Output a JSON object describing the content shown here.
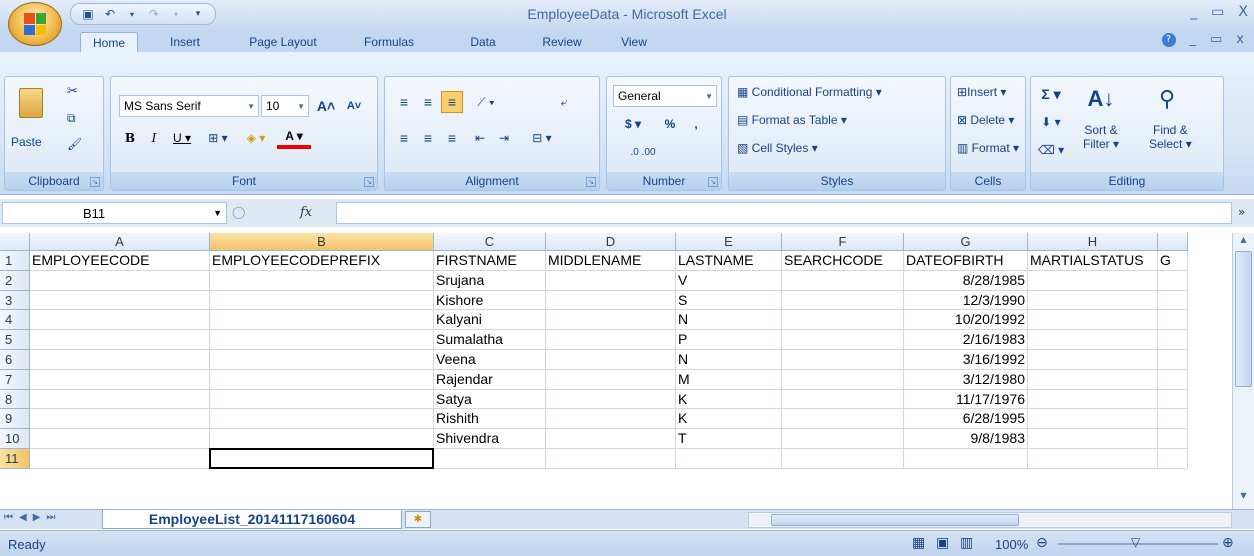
{
  "window": {
    "title": "EmployeeData - Microsoft Excel",
    "minimize": "_",
    "maximize": "▭",
    "close": "X"
  },
  "tabs": [
    "Home",
    "Insert",
    "Page Layout",
    "Formulas",
    "Data",
    "Review",
    "View"
  ],
  "active_tab": "Home",
  "ribbon": {
    "clipboard": {
      "label": "Clipboard",
      "paste": "Paste"
    },
    "font": {
      "label": "Font",
      "font_name": "MS Sans Serif",
      "font_size": "10"
    },
    "alignment": {
      "label": "Alignment"
    },
    "number": {
      "label": "Number",
      "format": "General"
    },
    "styles": {
      "label": "Styles",
      "conditional": "Conditional Formatting",
      "format_table": "Format as Table",
      "cell_styles": "Cell Styles"
    },
    "cells": {
      "label": "Cells",
      "insert": "Insert",
      "delete": "Delete",
      "format": "Format"
    },
    "editing": {
      "label": "Editing",
      "sort_filter": "Sort &",
      "sort_filter2": "Filter",
      "find_select": "Find &",
      "find_select2": "Select"
    }
  },
  "formula_bar": {
    "name_box": "B11",
    "fx": "fx",
    "value": ""
  },
  "columns": [
    "A",
    "B",
    "C",
    "D",
    "E",
    "F",
    "G",
    "H"
  ],
  "column_overflow": "G",
  "rows": [
    "1",
    "2",
    "3",
    "4",
    "5",
    "6",
    "7",
    "8",
    "9",
    "10",
    "11"
  ],
  "sheet": {
    "header": [
      "EMPLOYEECODE",
      "EMPLOYEECODEPREFIX",
      "FIRSTNAME",
      "MIDDLENAME",
      "LASTNAME",
      "SEARCHCODE",
      "DATEOFBIRTH",
      "MARTIALSTATUS"
    ],
    "data": [
      [
        "",
        "",
        "Srujana",
        "",
        "V",
        "",
        "8/28/1985",
        ""
      ],
      [
        "",
        "",
        "Kishore",
        "",
        "S",
        "",
        "12/3/1990",
        ""
      ],
      [
        "",
        "",
        "Kalyani",
        "",
        "N",
        "",
        "10/20/1992",
        ""
      ],
      [
        "",
        "",
        "Sumalatha",
        "",
        "P",
        "",
        "2/16/1983",
        ""
      ],
      [
        "",
        "",
        "Veena",
        "",
        "N",
        "",
        "3/16/1992",
        ""
      ],
      [
        "",
        "",
        "Rajendar",
        "",
        "M",
        "",
        "3/12/1980",
        ""
      ],
      [
        "",
        "",
        "Satya",
        "",
        "K",
        "",
        "11/17/1976",
        ""
      ],
      [
        "",
        "",
        "Rishith",
        "",
        "K",
        "",
        "6/28/1995",
        ""
      ],
      [
        "",
        "",
        "Shivendra",
        "",
        "T",
        "",
        "9/8/1983",
        ""
      ],
      [
        "",
        "",
        "",
        "",
        "",
        "",
        "",
        ""
      ]
    ]
  },
  "sheet_tab": "EmployeeList_20141117160604",
  "status": {
    "text": "Ready",
    "zoom": "100%"
  },
  "colors": {
    "ribbon": "#d5e4f5",
    "selected_header": "#f4c26a",
    "text": "#15428b"
  }
}
